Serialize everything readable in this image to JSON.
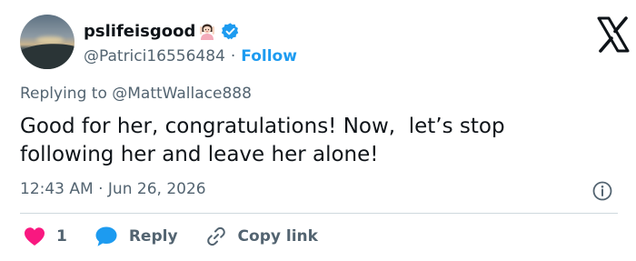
{
  "tweet": {
    "display_name": "pslifeisgood",
    "handle": "@Patrici16556484",
    "separator": "·",
    "follow_label": "Follow",
    "replying_prefix": "Replying to",
    "replying_to": "@MattWallace888",
    "text": "Good for her, congratulations! Now,  let’s stop\nfollowing her and leave her alone!",
    "time": "12:43 AM",
    "date_separator": "·",
    "date": "Jun 26, 2026"
  },
  "actions": {
    "like_count": "1",
    "reply_label": "Reply",
    "copy_link_label": "Copy link"
  },
  "icons": {
    "verified": "verified-badge-icon",
    "emoji": "person-gesturing-ok-emoji",
    "brand": "x-logo",
    "info": "info-icon",
    "like": "heart-icon",
    "reply": "speech-bubble-icon",
    "link": "link-icon"
  },
  "colors": {
    "accent": "#1d9bf0",
    "like": "#f91880",
    "text": "#0f1419",
    "muted": "#536471",
    "divider": "#cfd9de"
  }
}
